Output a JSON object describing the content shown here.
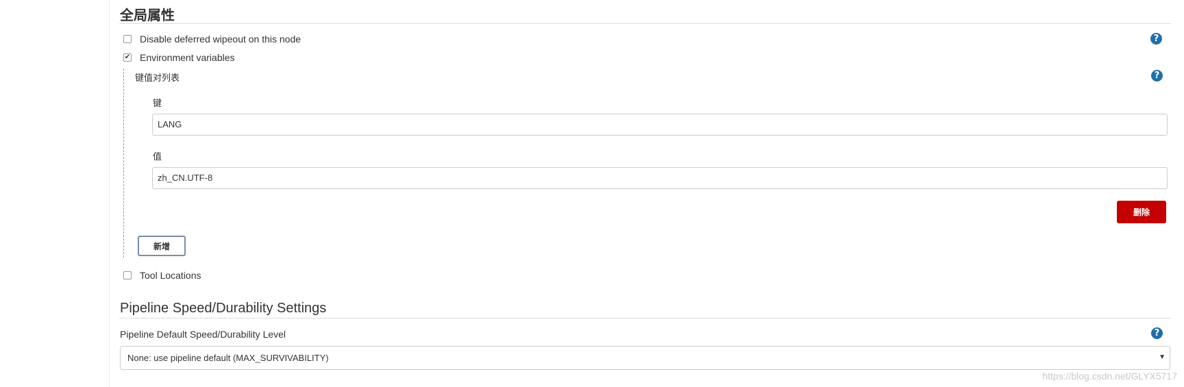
{
  "global_props": {
    "title": "全局属性",
    "disable_wipeout": {
      "label": "Disable deferred wipeout on this node",
      "checked": false
    },
    "env_vars": {
      "label": "Environment variables",
      "checked": true
    },
    "kv_list": {
      "label": "键值对列表",
      "key_label": "键",
      "key_value": "LANG",
      "value_label": "值",
      "value_value": "zh_CN.UTF-8",
      "delete_label": "删除",
      "add_label": "新增"
    },
    "tool_locations": {
      "label": "Tool Locations",
      "checked": false
    }
  },
  "pipeline": {
    "title": "Pipeline Speed/Durability Settings",
    "level_label": "Pipeline Default Speed/Durability Level",
    "level_selected": "None: use pipeline default (MAX_SURVIVABILITY)"
  },
  "help_icon": "?",
  "watermark": "https://blog.csdn.net/GLYX5717",
  "colors": {
    "help": "#1f6fa8",
    "delete": "#c40000",
    "rule": "#dddddd"
  }
}
